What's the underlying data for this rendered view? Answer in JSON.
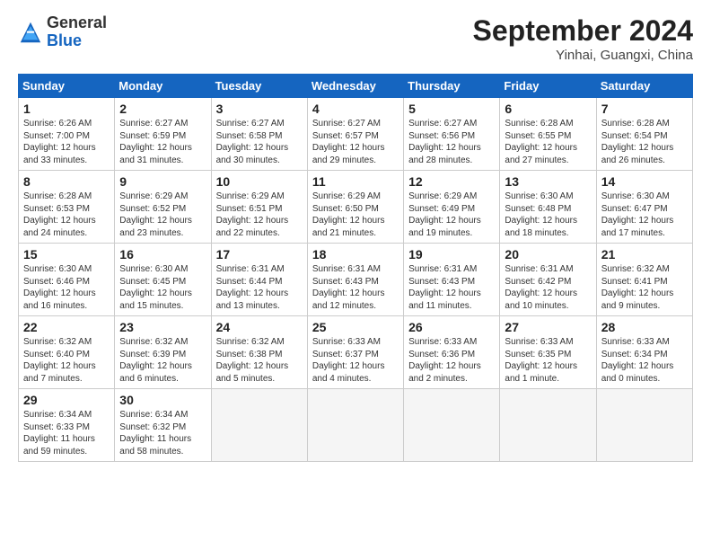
{
  "header": {
    "logo_general": "General",
    "logo_blue": "Blue",
    "month_title": "September 2024",
    "location": "Yinhai, Guangxi, China"
  },
  "days_of_week": [
    "Sunday",
    "Monday",
    "Tuesday",
    "Wednesday",
    "Thursday",
    "Friday",
    "Saturday"
  ],
  "weeks": [
    [
      {
        "num": "1",
        "info": "Sunrise: 6:26 AM\nSunset: 7:00 PM\nDaylight: 12 hours\nand 33 minutes."
      },
      {
        "num": "2",
        "info": "Sunrise: 6:27 AM\nSunset: 6:59 PM\nDaylight: 12 hours\nand 31 minutes."
      },
      {
        "num": "3",
        "info": "Sunrise: 6:27 AM\nSunset: 6:58 PM\nDaylight: 12 hours\nand 30 minutes."
      },
      {
        "num": "4",
        "info": "Sunrise: 6:27 AM\nSunset: 6:57 PM\nDaylight: 12 hours\nand 29 minutes."
      },
      {
        "num": "5",
        "info": "Sunrise: 6:27 AM\nSunset: 6:56 PM\nDaylight: 12 hours\nand 28 minutes."
      },
      {
        "num": "6",
        "info": "Sunrise: 6:28 AM\nSunset: 6:55 PM\nDaylight: 12 hours\nand 27 minutes."
      },
      {
        "num": "7",
        "info": "Sunrise: 6:28 AM\nSunset: 6:54 PM\nDaylight: 12 hours\nand 26 minutes."
      }
    ],
    [
      {
        "num": "8",
        "info": "Sunrise: 6:28 AM\nSunset: 6:53 PM\nDaylight: 12 hours\nand 24 minutes."
      },
      {
        "num": "9",
        "info": "Sunrise: 6:29 AM\nSunset: 6:52 PM\nDaylight: 12 hours\nand 23 minutes."
      },
      {
        "num": "10",
        "info": "Sunrise: 6:29 AM\nSunset: 6:51 PM\nDaylight: 12 hours\nand 22 minutes."
      },
      {
        "num": "11",
        "info": "Sunrise: 6:29 AM\nSunset: 6:50 PM\nDaylight: 12 hours\nand 21 minutes."
      },
      {
        "num": "12",
        "info": "Sunrise: 6:29 AM\nSunset: 6:49 PM\nDaylight: 12 hours\nand 19 minutes."
      },
      {
        "num": "13",
        "info": "Sunrise: 6:30 AM\nSunset: 6:48 PM\nDaylight: 12 hours\nand 18 minutes."
      },
      {
        "num": "14",
        "info": "Sunrise: 6:30 AM\nSunset: 6:47 PM\nDaylight: 12 hours\nand 17 minutes."
      }
    ],
    [
      {
        "num": "15",
        "info": "Sunrise: 6:30 AM\nSunset: 6:46 PM\nDaylight: 12 hours\nand 16 minutes."
      },
      {
        "num": "16",
        "info": "Sunrise: 6:30 AM\nSunset: 6:45 PM\nDaylight: 12 hours\nand 15 minutes."
      },
      {
        "num": "17",
        "info": "Sunrise: 6:31 AM\nSunset: 6:44 PM\nDaylight: 12 hours\nand 13 minutes."
      },
      {
        "num": "18",
        "info": "Sunrise: 6:31 AM\nSunset: 6:43 PM\nDaylight: 12 hours\nand 12 minutes."
      },
      {
        "num": "19",
        "info": "Sunrise: 6:31 AM\nSunset: 6:43 PM\nDaylight: 12 hours\nand 11 minutes."
      },
      {
        "num": "20",
        "info": "Sunrise: 6:31 AM\nSunset: 6:42 PM\nDaylight: 12 hours\nand 10 minutes."
      },
      {
        "num": "21",
        "info": "Sunrise: 6:32 AM\nSunset: 6:41 PM\nDaylight: 12 hours\nand 9 minutes."
      }
    ],
    [
      {
        "num": "22",
        "info": "Sunrise: 6:32 AM\nSunset: 6:40 PM\nDaylight: 12 hours\nand 7 minutes."
      },
      {
        "num": "23",
        "info": "Sunrise: 6:32 AM\nSunset: 6:39 PM\nDaylight: 12 hours\nand 6 minutes."
      },
      {
        "num": "24",
        "info": "Sunrise: 6:32 AM\nSunset: 6:38 PM\nDaylight: 12 hours\nand 5 minutes."
      },
      {
        "num": "25",
        "info": "Sunrise: 6:33 AM\nSunset: 6:37 PM\nDaylight: 12 hours\nand 4 minutes."
      },
      {
        "num": "26",
        "info": "Sunrise: 6:33 AM\nSunset: 6:36 PM\nDaylight: 12 hours\nand 2 minutes."
      },
      {
        "num": "27",
        "info": "Sunrise: 6:33 AM\nSunset: 6:35 PM\nDaylight: 12 hours\nand 1 minute."
      },
      {
        "num": "28",
        "info": "Sunrise: 6:33 AM\nSunset: 6:34 PM\nDaylight: 12 hours\nand 0 minutes."
      }
    ],
    [
      {
        "num": "29",
        "info": "Sunrise: 6:34 AM\nSunset: 6:33 PM\nDaylight: 11 hours\nand 59 minutes."
      },
      {
        "num": "30",
        "info": "Sunrise: 6:34 AM\nSunset: 6:32 PM\nDaylight: 11 hours\nand 58 minutes."
      },
      {
        "num": "",
        "info": ""
      },
      {
        "num": "",
        "info": ""
      },
      {
        "num": "",
        "info": ""
      },
      {
        "num": "",
        "info": ""
      },
      {
        "num": "",
        "info": ""
      }
    ]
  ]
}
